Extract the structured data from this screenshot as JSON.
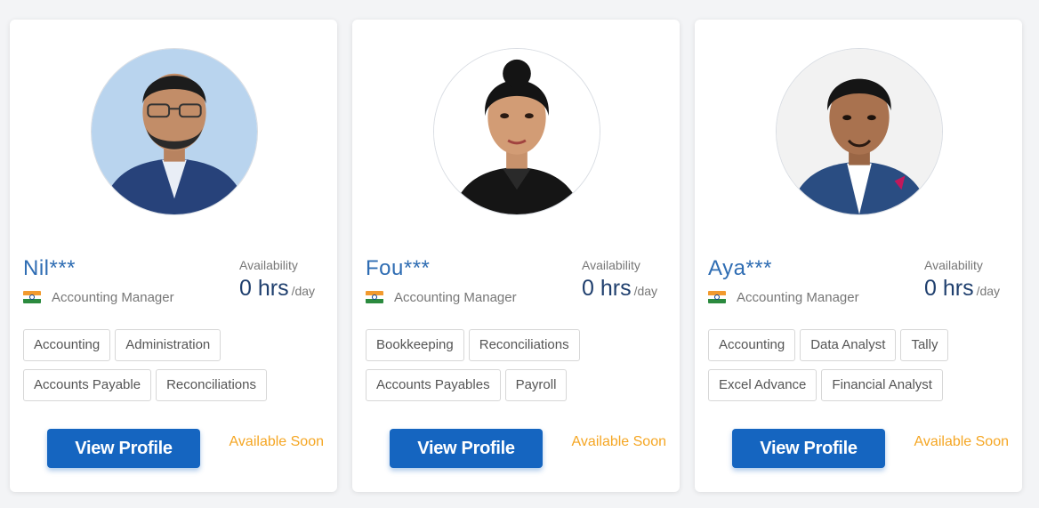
{
  "colors": {
    "accent_button": "#1565c0",
    "name_text": "#2f6db3",
    "available_soon": "#f5a623",
    "hours_value": "#1f3f6e"
  },
  "cards": [
    {
      "name": "Nil***",
      "country_flag_icon": "india-flag-icon",
      "role": "Accounting Manager",
      "availability_label": "Availability",
      "hours": "0 hrs",
      "per_day": "/day",
      "skills": [
        "Accounting",
        "Administration",
        "Accounts Payable",
        "Reconciliations"
      ],
      "button_label": "View Profile",
      "status": "Available Soon",
      "avatar_icon": "profile-photo-icon"
    },
    {
      "name": "Fou***",
      "country_flag_icon": "india-flag-icon",
      "role": "Accounting Manager",
      "availability_label": "Availability",
      "hours": "0 hrs",
      "per_day": "/day",
      "skills": [
        "Bookkeeping",
        "Reconciliations",
        "Accounts Payables",
        "Payroll"
      ],
      "button_label": "View Profile",
      "status": "Available Soon",
      "avatar_icon": "profile-photo-icon"
    },
    {
      "name": "Aya***",
      "country_flag_icon": "india-flag-icon",
      "role": "Accounting Manager",
      "availability_label": "Availability",
      "hours": "0 hrs",
      "per_day": "/day",
      "skills": [
        "Accounting",
        "Data Analyst",
        "Tally",
        "Excel Advance",
        "Financial Analyst"
      ],
      "button_label": "View Profile",
      "status": "Available Soon",
      "avatar_icon": "profile-photo-icon"
    }
  ]
}
